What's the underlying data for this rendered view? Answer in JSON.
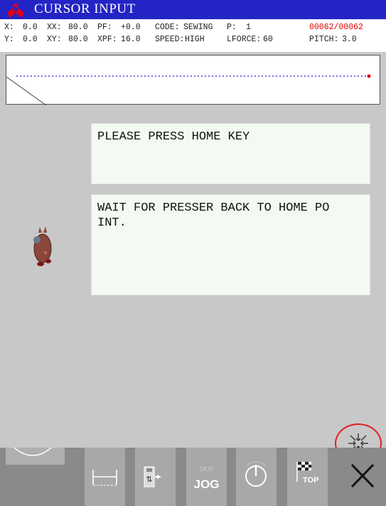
{
  "header": {
    "title": "CURSOR INPUT"
  },
  "status": {
    "x_label": "X:",
    "x_value": "0.0",
    "xx_label": "XX:",
    "xx_value": "80.0",
    "pf_label": "PF:",
    "pf_value": "+0.0",
    "code_label": "CODE:",
    "code_value": "SEWING",
    "p_label": "P:",
    "p_value": "1",
    "counter": "00062/00062",
    "y_label": "Y:",
    "y_value": "0.0",
    "xy_label": "XY:",
    "xy_value": "80.0",
    "xpf_label": "XPF:",
    "xpf_value": "16.0",
    "speed_label": "SPEED:",
    "speed_value": "HIGH",
    "lforce_label": "LFORCE:",
    "lforce_value": "60",
    "pitch_label": "PITCH:",
    "pitch_value": "3.0"
  },
  "messages": {
    "line1": "PLEASE PRESS HOME KEY",
    "line2_a": "WAIT FOR PRESSER BACK TO HOME PO",
    "line2_b": "INT."
  },
  "toolbar": {
    "skip_label": "SKIP",
    "jog_label": "JOG",
    "top_label": "TOP"
  },
  "colors": {
    "title_bar": "#2424c6",
    "counter_red": "#e60000",
    "preview_line": "#1a1ad8",
    "highlight_ring": "#e02020"
  },
  "icons": {
    "logo": "mitsubishi-logo-icon",
    "reset": "home-reset-icon",
    "stitch_width": "stitch-width-icon",
    "usb": "usb-transfer-icon",
    "jog": "skip-jog-icon",
    "power": "power-dial-icon",
    "top": "checkered-flag-top-icon",
    "close": "close-icon"
  }
}
